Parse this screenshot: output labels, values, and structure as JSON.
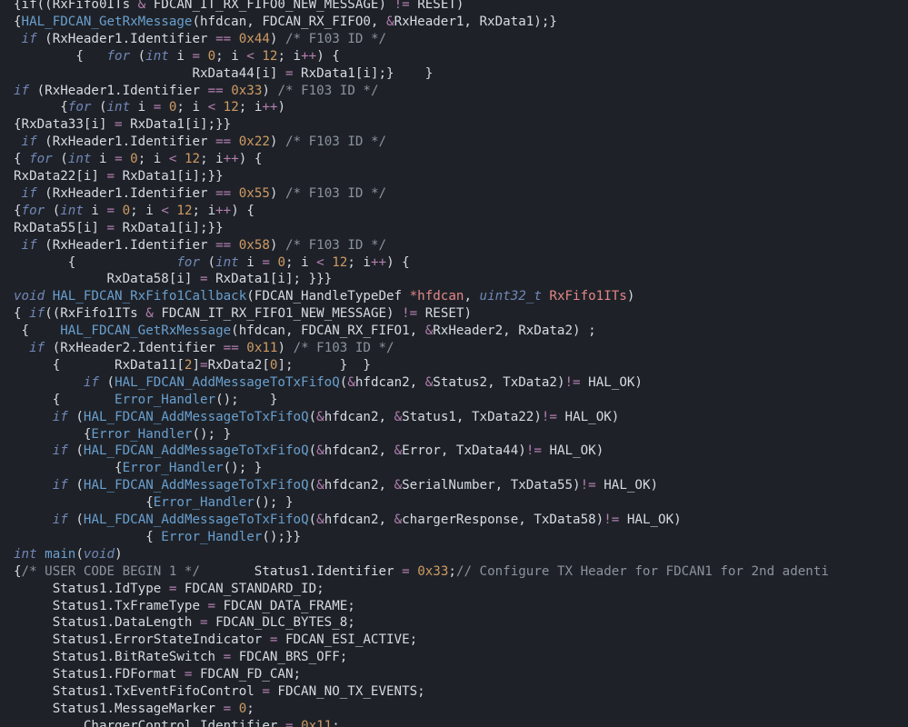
{
  "lines": [
    [
      [
        "p",
        "{if((RxFifo0ITs "
      ],
      [
        "op",
        "&"
      ],
      [
        "p",
        " FDCAN_IT_RX_FIFO0_NEW_MESSAGE) "
      ],
      [
        "op",
        "!="
      ],
      [
        "p",
        " RESET)"
      ]
    ],
    [
      [
        "p",
        "{"
      ],
      [
        "fn",
        "HAL_FDCAN_GetRxMessage"
      ],
      [
        "p",
        "(hfdcan, FDCAN_RX_FIFO0, "
      ],
      [
        "op",
        "&"
      ],
      [
        "p",
        "RxHeader1, RxData1);}"
      ]
    ],
    [
      [
        "p",
        " "
      ],
      [
        "kw",
        "if"
      ],
      [
        "p",
        " (RxHeader1.Identifier "
      ],
      [
        "op",
        "=="
      ],
      [
        "p",
        " "
      ],
      [
        "num",
        "0x44"
      ],
      [
        "p",
        ") "
      ],
      [
        "cm",
        "/* F103 ID */"
      ]
    ],
    [
      [
        "p",
        "        {   "
      ],
      [
        "kw",
        "for"
      ],
      [
        "p",
        " ("
      ],
      [
        "kw",
        "int"
      ],
      [
        "p",
        " i "
      ],
      [
        "op",
        "="
      ],
      [
        "p",
        " "
      ],
      [
        "num",
        "0"
      ],
      [
        "p",
        "; i "
      ],
      [
        "op",
        "<"
      ],
      [
        "p",
        " "
      ],
      [
        "num",
        "12"
      ],
      [
        "p",
        "; i"
      ],
      [
        "op",
        "++"
      ],
      [
        "p",
        ") {"
      ]
    ],
    [
      [
        "p",
        "                       RxData44[i] "
      ],
      [
        "op",
        "="
      ],
      [
        "p",
        " RxData1[i];}    }"
      ]
    ],
    [
      [
        "kw",
        "if"
      ],
      [
        "p",
        " (RxHeader1.Identifier "
      ],
      [
        "op",
        "=="
      ],
      [
        "p",
        " "
      ],
      [
        "num",
        "0x33"
      ],
      [
        "p",
        ") "
      ],
      [
        "cm",
        "/* F103 ID */"
      ]
    ],
    [
      [
        "p",
        "      {"
      ],
      [
        "kw",
        "for"
      ],
      [
        "p",
        " ("
      ],
      [
        "kw",
        "int"
      ],
      [
        "p",
        " i "
      ],
      [
        "op",
        "="
      ],
      [
        "p",
        " "
      ],
      [
        "num",
        "0"
      ],
      [
        "p",
        "; i "
      ],
      [
        "op",
        "<"
      ],
      [
        "p",
        " "
      ],
      [
        "num",
        "12"
      ],
      [
        "p",
        "; i"
      ],
      [
        "op",
        "++"
      ],
      [
        "p",
        ")"
      ]
    ],
    [
      [
        "p",
        "{RxData33[i] "
      ],
      [
        "op",
        "="
      ],
      [
        "p",
        " RxData1[i];}}"
      ]
    ],
    [
      [
        "p",
        " "
      ],
      [
        "kw",
        "if"
      ],
      [
        "p",
        " (RxHeader1.Identifier "
      ],
      [
        "op",
        "=="
      ],
      [
        "p",
        " "
      ],
      [
        "num",
        "0x22"
      ],
      [
        "p",
        ") "
      ],
      [
        "cm",
        "/* F103 ID */"
      ]
    ],
    [
      [
        "p",
        "{ "
      ],
      [
        "kw",
        "for"
      ],
      [
        "p",
        " ("
      ],
      [
        "kw",
        "int"
      ],
      [
        "p",
        " i "
      ],
      [
        "op",
        "="
      ],
      [
        "p",
        " "
      ],
      [
        "num",
        "0"
      ],
      [
        "p",
        "; i "
      ],
      [
        "op",
        "<"
      ],
      [
        "p",
        " "
      ],
      [
        "num",
        "12"
      ],
      [
        "p",
        "; i"
      ],
      [
        "op",
        "++"
      ],
      [
        "p",
        ") {"
      ]
    ],
    [
      [
        "p",
        "RxData22[i] "
      ],
      [
        "op",
        "="
      ],
      [
        "p",
        " RxData1[i];}}"
      ]
    ],
    [
      [
        "p",
        " "
      ],
      [
        "kw",
        "if"
      ],
      [
        "p",
        " (RxHeader1.Identifier "
      ],
      [
        "op",
        "=="
      ],
      [
        "p",
        " "
      ],
      [
        "num",
        "0x55"
      ],
      [
        "p",
        ") "
      ],
      [
        "cm",
        "/* F103 ID */"
      ]
    ],
    [
      [
        "p",
        "{"
      ],
      [
        "kw",
        "for"
      ],
      [
        "p",
        " ("
      ],
      [
        "kw",
        "int"
      ],
      [
        "p",
        " i "
      ],
      [
        "op",
        "="
      ],
      [
        "p",
        " "
      ],
      [
        "num",
        "0"
      ],
      [
        "p",
        "; i "
      ],
      [
        "op",
        "<"
      ],
      [
        "p",
        " "
      ],
      [
        "num",
        "12"
      ],
      [
        "p",
        "; i"
      ],
      [
        "op",
        "++"
      ],
      [
        "p",
        ") {"
      ]
    ],
    [
      [
        "p",
        "RxData55[i] "
      ],
      [
        "op",
        "="
      ],
      [
        "p",
        " RxData1[i];}}"
      ]
    ],
    [
      [
        "p",
        " "
      ],
      [
        "kw",
        "if"
      ],
      [
        "p",
        " (RxHeader1.Identifier "
      ],
      [
        "op",
        "=="
      ],
      [
        "p",
        " "
      ],
      [
        "num",
        "0x58"
      ],
      [
        "p",
        ") "
      ],
      [
        "cm",
        "/* F103 ID */"
      ]
    ],
    [
      [
        "p",
        "       {             "
      ],
      [
        "kw",
        "for"
      ],
      [
        "p",
        " ("
      ],
      [
        "kw",
        "int"
      ],
      [
        "p",
        " i "
      ],
      [
        "op",
        "="
      ],
      [
        "p",
        " "
      ],
      [
        "num",
        "0"
      ],
      [
        "p",
        "; i "
      ],
      [
        "op",
        "<"
      ],
      [
        "p",
        " "
      ],
      [
        "num",
        "12"
      ],
      [
        "p",
        "; i"
      ],
      [
        "op",
        "++"
      ],
      [
        "p",
        ") {"
      ]
    ],
    [
      [
        "p",
        "            RxData58[i] "
      ],
      [
        "op",
        "="
      ],
      [
        "p",
        " RxData1[i]; }}}"
      ]
    ],
    [
      [
        "kw",
        "void"
      ],
      [
        "p",
        " "
      ],
      [
        "fn",
        "HAL_FDCAN_RxFifo1Callback"
      ],
      [
        "p",
        "(FDCAN_HandleTypeDef "
      ],
      [
        "pr",
        "*hfdcan"
      ],
      [
        "p",
        ", "
      ],
      [
        "kw",
        "uint32_t"
      ],
      [
        "p",
        " "
      ],
      [
        "pr",
        "RxFifo1ITs"
      ],
      [
        "p",
        ")"
      ]
    ],
    [
      [
        "p",
        "{ "
      ],
      [
        "kw",
        "if"
      ],
      [
        "p",
        "((RxFifo1ITs "
      ],
      [
        "op",
        "&"
      ],
      [
        "p",
        " FDCAN_IT_RX_FIFO1_NEW_MESSAGE) "
      ],
      [
        "op",
        "!="
      ],
      [
        "p",
        " RESET)"
      ]
    ],
    [
      [
        "p",
        " {    "
      ],
      [
        "fn",
        "HAL_FDCAN_GetRxMessage"
      ],
      [
        "p",
        "(hfdcan, FDCAN_RX_FIFO1, "
      ],
      [
        "op",
        "&"
      ],
      [
        "p",
        "RxHeader2, RxData2) ;"
      ]
    ],
    [
      [
        "p",
        "  "
      ],
      [
        "kw",
        "if"
      ],
      [
        "p",
        " (RxHeader2.Identifier "
      ],
      [
        "op",
        "=="
      ],
      [
        "p",
        " "
      ],
      [
        "num",
        "0x11"
      ],
      [
        "p",
        ") "
      ],
      [
        "cm",
        "/* F103 ID */"
      ]
    ],
    [
      [
        "p",
        "     {       RxData11["
      ],
      [
        "num",
        "2"
      ],
      [
        "p",
        "]"
      ],
      [
        "op",
        "="
      ],
      [
        "p",
        "RxData2["
      ],
      [
        "num",
        "0"
      ],
      [
        "p",
        "];      }  }"
      ]
    ],
    [
      [
        "p",
        "         "
      ],
      [
        "kw",
        "if"
      ],
      [
        "p",
        " ("
      ],
      [
        "fn",
        "HAL_FDCAN_AddMessageToTxFifoQ"
      ],
      [
        "p",
        "("
      ],
      [
        "op",
        "&"
      ],
      [
        "p",
        "hfdcan2, "
      ],
      [
        "op",
        "&"
      ],
      [
        "p",
        "Status2, TxData2)"
      ],
      [
        "op",
        "!="
      ],
      [
        "p",
        " HAL_OK)"
      ]
    ],
    [
      [
        "p",
        "     {       "
      ],
      [
        "fn",
        "Error_Handler"
      ],
      [
        "p",
        "();    }"
      ]
    ],
    [
      [
        "p",
        "     "
      ],
      [
        "kw",
        "if"
      ],
      [
        "p",
        " ("
      ],
      [
        "fn",
        "HAL_FDCAN_AddMessageToTxFifoQ"
      ],
      [
        "p",
        "("
      ],
      [
        "op",
        "&"
      ],
      [
        "p",
        "hfdcan2, "
      ],
      [
        "op",
        "&"
      ],
      [
        "p",
        "Status1, TxData22)"
      ],
      [
        "op",
        "!="
      ],
      [
        "p",
        " HAL_OK)"
      ]
    ],
    [
      [
        "p",
        "         {"
      ],
      [
        "fn",
        "Error_Handler"
      ],
      [
        "p",
        "(); }"
      ]
    ],
    [
      [
        "p",
        "     "
      ],
      [
        "kw",
        "if"
      ],
      [
        "p",
        " ("
      ],
      [
        "fn",
        "HAL_FDCAN_AddMessageToTxFifoQ"
      ],
      [
        "p",
        "("
      ],
      [
        "op",
        "&"
      ],
      [
        "p",
        "hfdcan2, "
      ],
      [
        "op",
        "&"
      ],
      [
        "p",
        "Error, TxData44)"
      ],
      [
        "op",
        "!="
      ],
      [
        "p",
        " HAL_OK)"
      ]
    ],
    [
      [
        "p",
        "             {"
      ],
      [
        "fn",
        "Error_Handler"
      ],
      [
        "p",
        "(); }"
      ]
    ],
    [
      [
        "p",
        "     "
      ],
      [
        "kw",
        "if"
      ],
      [
        "p",
        " ("
      ],
      [
        "fn",
        "HAL_FDCAN_AddMessageToTxFifoQ"
      ],
      [
        "p",
        "("
      ],
      [
        "op",
        "&"
      ],
      [
        "p",
        "hfdcan2, "
      ],
      [
        "op",
        "&"
      ],
      [
        "p",
        "SerialNumber, TxData55)"
      ],
      [
        "op",
        "!="
      ],
      [
        "p",
        " HAL_OK)"
      ]
    ],
    [
      [
        "p",
        "                 {"
      ],
      [
        "fn",
        "Error_Handler"
      ],
      [
        "p",
        "(); }"
      ]
    ],
    [
      [
        "p",
        "     "
      ],
      [
        "kw",
        "if"
      ],
      [
        "p",
        " ("
      ],
      [
        "fn",
        "HAL_FDCAN_AddMessageToTxFifoQ"
      ],
      [
        "p",
        "("
      ],
      [
        "op",
        "&"
      ],
      [
        "p",
        "hfdcan2, "
      ],
      [
        "op",
        "&"
      ],
      [
        "p",
        "chargerResponse, TxData58)"
      ],
      [
        "op",
        "!="
      ],
      [
        "p",
        " HAL_OK)"
      ]
    ],
    [
      [
        "p",
        "                 { "
      ],
      [
        "fn",
        "Error_Handler"
      ],
      [
        "p",
        "();}}"
      ]
    ],
    [
      [
        "kw",
        "int"
      ],
      [
        "p",
        " "
      ],
      [
        "fn",
        "main"
      ],
      [
        "p",
        "("
      ],
      [
        "kw",
        "void"
      ],
      [
        "p",
        ")"
      ]
    ],
    [
      [
        "p",
        "{"
      ],
      [
        "cm",
        "/* USER CODE BEGIN 1 */"
      ],
      [
        "p",
        "       Status1.Identifier "
      ],
      [
        "op",
        "="
      ],
      [
        "p",
        " "
      ],
      [
        "num",
        "0x33"
      ],
      [
        "p",
        ";"
      ],
      [
        "cm",
        "// Configure TX Header for FDCAN1 for 2nd adenti"
      ]
    ],
    [
      [
        "p",
        "     Status1.IdType "
      ],
      [
        "op",
        "="
      ],
      [
        "p",
        " FDCAN_STANDARD_ID;"
      ]
    ],
    [
      [
        "p",
        "     Status1.TxFrameType "
      ],
      [
        "op",
        "="
      ],
      [
        "p",
        " FDCAN_DATA_FRAME;"
      ]
    ],
    [
      [
        "p",
        "     Status1.DataLength "
      ],
      [
        "op",
        "="
      ],
      [
        "p",
        " FDCAN_DLC_BYTES_8;"
      ]
    ],
    [
      [
        "p",
        "     Status1.ErrorStateIndicator "
      ],
      [
        "op",
        "="
      ],
      [
        "p",
        " FDCAN_ESI_ACTIVE;"
      ]
    ],
    [
      [
        "p",
        "     Status1.BitRateSwitch "
      ],
      [
        "op",
        "="
      ],
      [
        "p",
        " FDCAN_BRS_OFF;"
      ]
    ],
    [
      [
        "p",
        "     Status1.FDFormat "
      ],
      [
        "op",
        "="
      ],
      [
        "p",
        " FDCAN_FD_CAN;"
      ]
    ],
    [
      [
        "p",
        "     Status1.TxEventFifoControl "
      ],
      [
        "op",
        "="
      ],
      [
        "p",
        " FDCAN_NO_TX_EVENTS;"
      ]
    ],
    [
      [
        "p",
        "     Status1.MessageMarker "
      ],
      [
        "op",
        "="
      ],
      [
        "p",
        " "
      ],
      [
        "num",
        "0"
      ],
      [
        "p",
        ";"
      ]
    ],
    [
      [
        "p",
        "         ChargerControl.Identifier "
      ],
      [
        "op",
        "="
      ],
      [
        "p",
        " "
      ],
      [
        "num",
        "0x11"
      ],
      [
        "p",
        ";"
      ]
    ]
  ]
}
